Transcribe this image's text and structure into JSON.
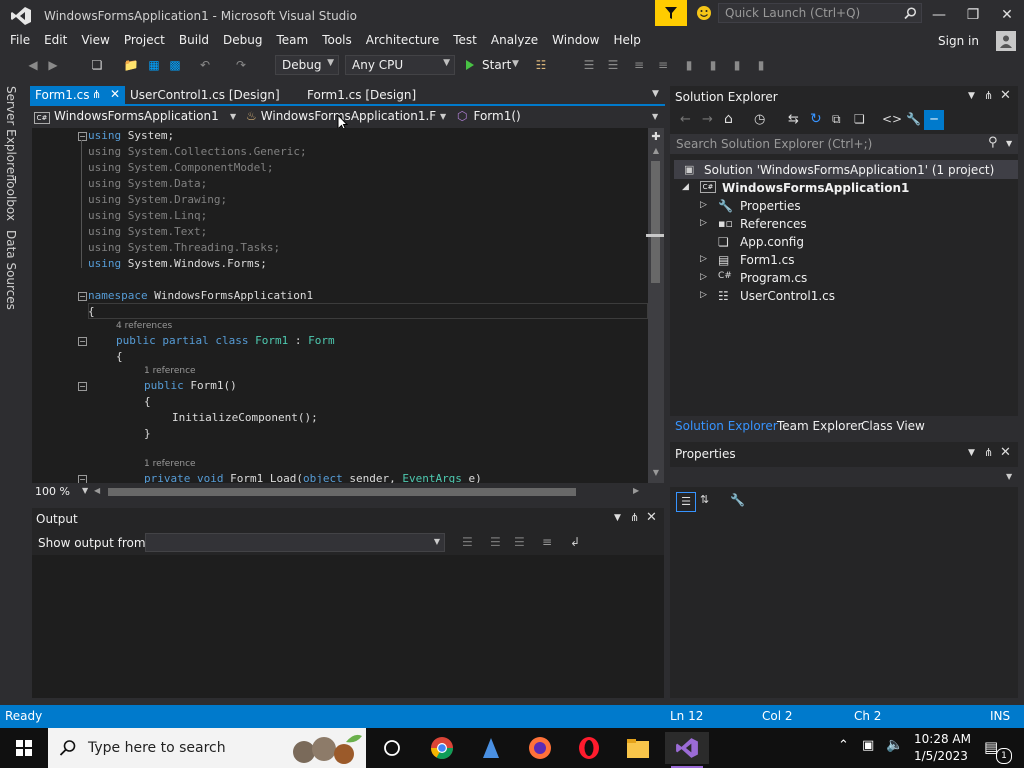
{
  "titlebar": {
    "title": "WindowsFormsApplication1 - Microsoft Visual Studio",
    "quick_launch_placeholder": "Quick Launch (Ctrl+Q)"
  },
  "menu": [
    "File",
    "Edit",
    "View",
    "Project",
    "Build",
    "Debug",
    "Team",
    "Tools",
    "Architecture",
    "Test",
    "Analyze",
    "Window",
    "Help"
  ],
  "signin": "Sign in",
  "toolbar": {
    "config": "Debug",
    "platform": "Any CPU",
    "start": "Start"
  },
  "side_tabs": [
    "Server Explorer",
    "Toolbox",
    "Data Sources"
  ],
  "doc_tabs": [
    {
      "label": "Form1.cs",
      "active": true
    },
    {
      "label": "UserControl1.cs [Design]",
      "active": false
    },
    {
      "label": "Form1.cs [Design]",
      "active": false
    }
  ],
  "nav": {
    "project": "WindowsFormsApplication1",
    "class": "WindowsFormsApplication1.Form1",
    "member": "Form1()"
  },
  "code": {
    "usings": [
      "System",
      "System.Collections.Generic",
      "System.ComponentModel",
      "System.Data",
      "System.Drawing",
      "System.Linq",
      "System.Text",
      "System.Threading.Tasks",
      "System.Windows.Forms"
    ],
    "using_kw": "using",
    "namespace_kw": "namespace",
    "namespace_name": "WindowsFormsApplication1",
    "ref4": "4 references",
    "ref1a": "1 reference",
    "ref1b": "1 reference",
    "class_kw": "public partial class",
    "class_name": "Form1",
    "class_sep": " : ",
    "class_base": "Form",
    "ctor_kw": "public",
    "ctor_name": "Form1()",
    "init": "InitializeComponent();",
    "load_kw": "private void",
    "load_name": "Form1_Load(",
    "load_obj": "object",
    "load_mid": " sender, ",
    "load_ea": "EventArgs",
    "load_end": " e)",
    "open_brace": "{",
    "close_brace": "}",
    "semi": ";"
  },
  "zoom": "100 %",
  "solution_explorer": {
    "title": "Solution Explorer",
    "search_placeholder": "Search Solution Explorer (Ctrl+;)",
    "solution": "Solution 'WindowsFormsApplication1' (1 project)",
    "project": "WindowsFormsApplication1",
    "items": [
      "Properties",
      "References",
      "App.config",
      "Form1.cs",
      "Program.cs",
      "UserControl1.cs"
    ],
    "tabs": [
      "Solution Explorer",
      "Team Explorer",
      "Class View"
    ]
  },
  "properties": {
    "title": "Properties"
  },
  "output": {
    "title": "Output",
    "show_from": "Show output from:"
  },
  "status": {
    "ready": "Ready",
    "ln": "Ln 12",
    "col": "Col 2",
    "ch": "Ch 2",
    "ins": "INS"
  },
  "taskbar": {
    "search_placeholder": "Type here to search",
    "time": "10:28 AM",
    "date": "1/5/2023",
    "notif_count": "1"
  },
  "colors": {
    "accent": "#007acc",
    "bg": "#2d2d30",
    "editor": "#1e1e1e"
  }
}
